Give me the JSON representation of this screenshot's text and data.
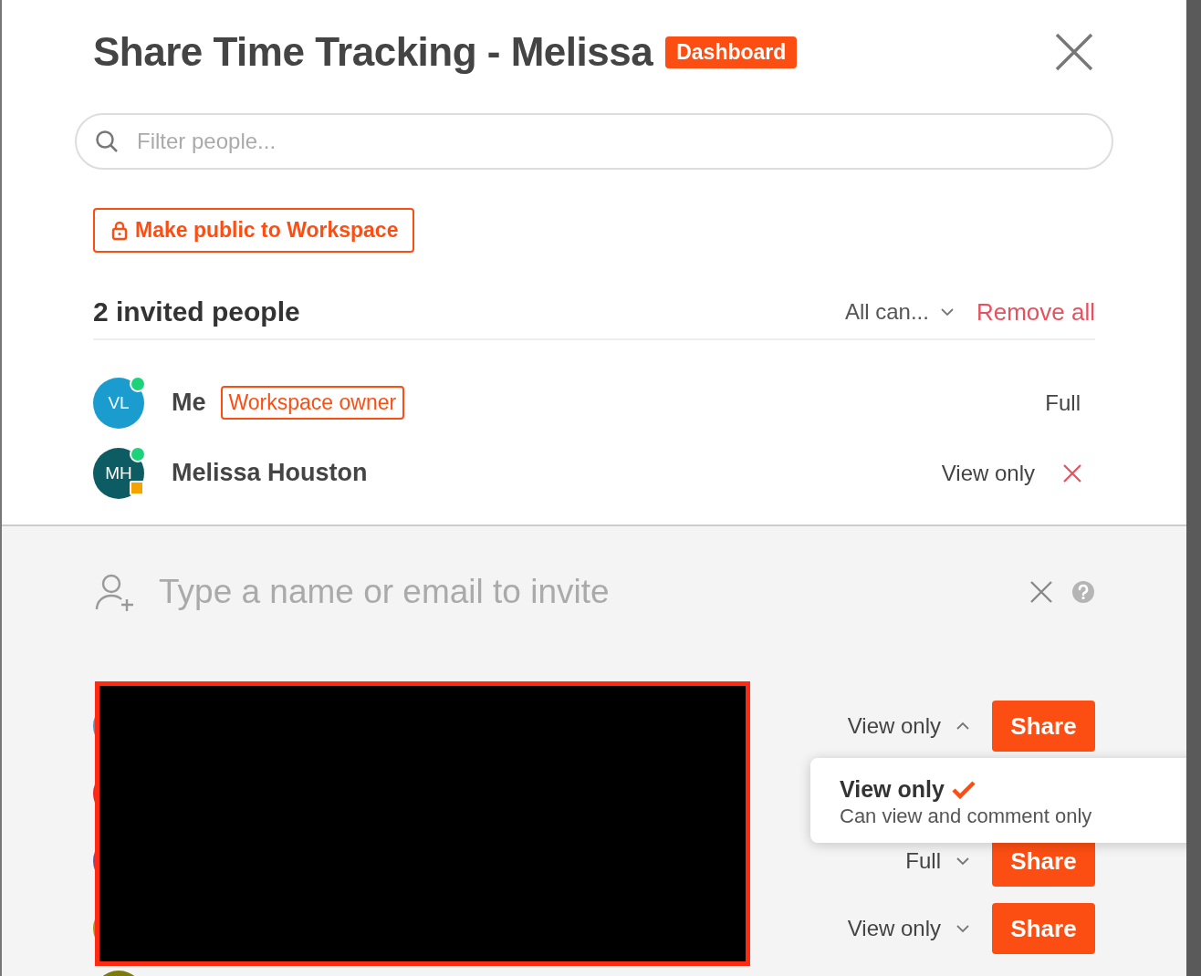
{
  "dialog": {
    "title": "Share Time Tracking - Melissa",
    "badge": "Dashboard"
  },
  "search": {
    "placeholder": "Filter people..."
  },
  "public_button": "Make public to Workspace",
  "invited": {
    "heading": "2 invited people",
    "filter": "All can...",
    "remove_all": "Remove all"
  },
  "people": [
    {
      "initials": "VL",
      "color": "#1a9ccf",
      "online": true,
      "name": "Me",
      "badge": "Workspace owner",
      "permission": "Full"
    },
    {
      "initials": "MH",
      "color": "#0d5c63",
      "online": true,
      "square": true,
      "name": "Melissa Houston",
      "permission": "View only",
      "removable": true
    }
  ],
  "invite": {
    "placeholder": "Type a name or email to invite"
  },
  "suggestions": [
    {
      "color": "#3f9bd6",
      "permission": "View only",
      "expanded": true,
      "share": "Share"
    },
    {
      "color": "#e8283c"
    },
    {
      "color": "#6257b0",
      "permission": "Full",
      "expanded": false,
      "share": "Share"
    },
    {
      "color": "#a09a12",
      "permission": "View only",
      "expanded": false,
      "share": "Share"
    },
    {
      "color": "#7d7a0c"
    }
  ],
  "permission_menu": [
    {
      "label": "View only",
      "description": "Can view and comment only",
      "selected": true
    }
  ]
}
